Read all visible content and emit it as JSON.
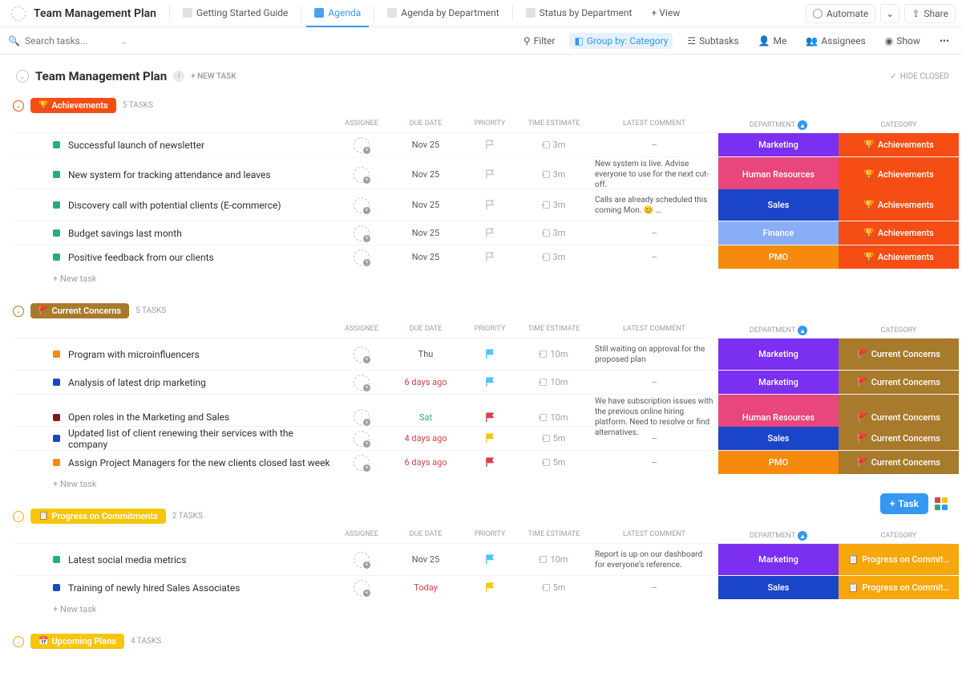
{
  "header": {
    "title": "Team Management Plan",
    "tabs": [
      {
        "label": "Getting Started Guide"
      },
      {
        "label": "Agenda",
        "active": true
      },
      {
        "label": "Agenda by Department"
      },
      {
        "label": "Status by Department"
      }
    ],
    "addView": "+ View",
    "automate": "Automate",
    "share": "Share"
  },
  "toolbar": {
    "searchPlaceholder": "Search tasks...",
    "filter": "Filter",
    "groupBy": "Group by: Category",
    "subtasks": "Subtasks",
    "me": "Me",
    "assignees": "Assignees",
    "show": "Show"
  },
  "page": {
    "title": "Team Management Plan",
    "newTask": "+ NEW TASK",
    "hideClosed": "HIDE CLOSED"
  },
  "columns": {
    "assignee": "ASSIGNEE",
    "due": "DUE DATE",
    "priority": "PRIORITY",
    "estimate": "TIME ESTIMATE",
    "comment": "LATEST COMMENT",
    "dept": "DEPARTMENT",
    "category": "CATEGORY"
  },
  "newTaskRow": "+ New task",
  "groups": [
    {
      "name": "Achievements",
      "icon": "🏆",
      "pillColor": "#f54d14",
      "count": "5 TASKS",
      "catClass": "cat-ach",
      "catIcon": "🏆",
      "catLabel": "Achievements",
      "chev": "#f54d14",
      "rows": [
        {
          "sq": "#2bac76",
          "name": "Successful launch of newsletter",
          "due": "Nov 25",
          "dueCls": "",
          "flag": "#c4c4c4",
          "est": "3m",
          "comment": "–",
          "dept": "Marketing",
          "deptCls": "dept-marketing",
          "tall": false
        },
        {
          "sq": "#2bac76",
          "name": "New system for tracking attendance and leaves",
          "due": "Nov 25",
          "dueCls": "",
          "flag": "#c4c4c4",
          "est": "3m",
          "comment": "New system is live. Advise everyone to use for the next cut-off.",
          "dept": "Human Resources",
          "deptCls": "dept-hr",
          "tall": true
        },
        {
          "sq": "#2bac76",
          "name": "Discovery call with potential clients (E-commerce)",
          "due": "Nov 25",
          "dueCls": "",
          "flag": "#c4c4c4",
          "est": "3m",
          "comment": "Calls are already scheduled this coming Mon. 😊 …",
          "dept": "Sales",
          "deptCls": "dept-sales",
          "tall": true
        },
        {
          "sq": "#2bac76",
          "name": "Budget savings last month",
          "due": "Nov 25",
          "dueCls": "",
          "flag": "#c4c4c4",
          "est": "3m",
          "comment": "–",
          "dept": "Finance",
          "deptCls": "dept-finance",
          "tall": false
        },
        {
          "sq": "#2bac76",
          "name": "Positive feedback from our clients",
          "due": "Nov 25",
          "dueCls": "",
          "flag": "#c4c4c4",
          "est": "3m",
          "comment": "–",
          "dept": "PMO",
          "deptCls": "dept-pmo",
          "tall": false
        }
      ]
    },
    {
      "name": "Current Concerns",
      "icon": "🚩",
      "pillColor": "#a87a2b",
      "count": "5 TASKS",
      "catClass": "cat-cc",
      "catIcon": "🚩",
      "catLabel": "Current Concerns",
      "chev": "#a87a2b",
      "rows": [
        {
          "sq": "#f58a0c",
          "name": "Program with microinfluencers",
          "due": "Thu",
          "dueCls": "thu",
          "flag": "#4fc3f7",
          "est": "10m",
          "comment": "Still waiting on approval for the proposed plan",
          "dept": "Marketing",
          "deptCls": "dept-marketing",
          "tall": true
        },
        {
          "sq": "#1a45c9",
          "name": "Analysis of latest drip marketing",
          "due": "6 days ago",
          "dueCls": "ago",
          "flag": "#4fc3f7",
          "est": "10m",
          "comment": "–",
          "dept": "Marketing",
          "deptCls": "dept-marketing",
          "tall": false
        },
        {
          "sq": "#7a1a1a",
          "name": "Open roles in the Marketing and Sales",
          "due": "Sat",
          "dueCls": "sat",
          "flag": "#d8414a",
          "est": "10m",
          "comment": "We have subscription issues with the previous online hiring platform. Need to resolve or find alternatives.",
          "dept": "Human Resources",
          "deptCls": "dept-hr",
          "tall": true
        },
        {
          "sq": "#1a45c9",
          "name": "Updated list of client renewing their services with the company",
          "due": "4 days ago",
          "dueCls": "ago",
          "flag": "#f5c60c",
          "est": "5m",
          "comment": "–",
          "dept": "Sales",
          "deptCls": "dept-sales",
          "tall": false
        },
        {
          "sq": "#f58a0c",
          "name": "Assign Project Managers for the new clients closed last week",
          "due": "6 days ago",
          "dueCls": "ago",
          "flag": "#d8414a",
          "est": "5m",
          "comment": "–",
          "dept": "PMO",
          "deptCls": "dept-pmo",
          "tall": false
        }
      ]
    },
    {
      "name": "Progress on Commitments",
      "icon": "📋",
      "pillColor": "#f5c60c",
      "count": "2 TASKS",
      "catClass": "cat-pc",
      "catIcon": "📋",
      "catLabel": "Progress on Commit…",
      "chev": "#f5a70c",
      "rows": [
        {
          "sq": "#2bac76",
          "name": "Latest social media metrics",
          "due": "Nov 25",
          "dueCls": "",
          "flag": "#4fc3f7",
          "est": "10m",
          "comment": "Report is up on our dashboard for everyone's reference.",
          "dept": "Marketing",
          "deptCls": "dept-marketing",
          "tall": true
        },
        {
          "sq": "#1a45c9",
          "name": "Training of newly hired Sales Associates",
          "due": "Today",
          "dueCls": "today",
          "flag": "#f5c60c",
          "est": "5m",
          "comment": "–",
          "dept": "Sales",
          "deptCls": "dept-sales",
          "tall": false
        }
      ]
    }
  ],
  "upcoming": {
    "name": "Upcoming Plans",
    "count": "4 TASKS",
    "pillColor": "#f5c60c"
  },
  "floatTask": "Task"
}
